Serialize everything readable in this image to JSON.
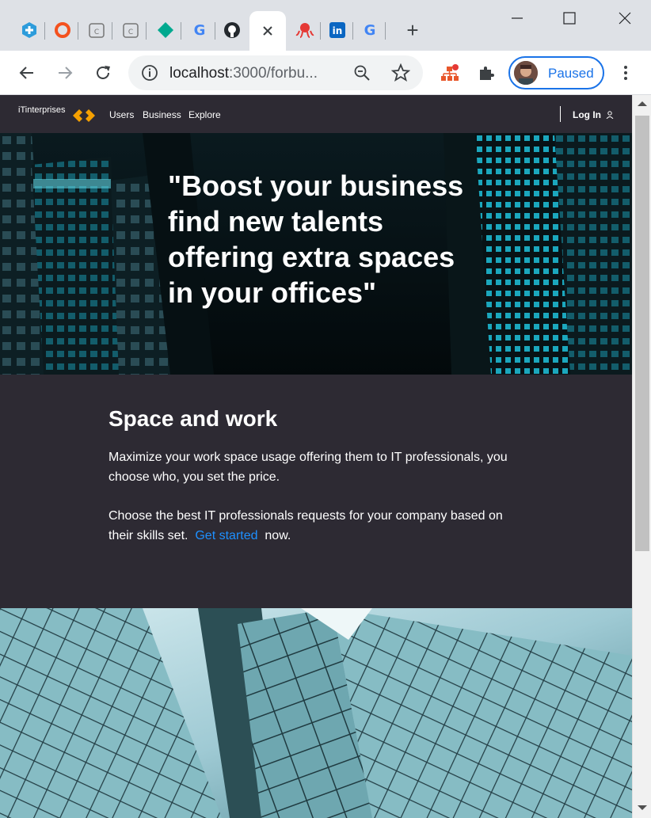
{
  "browser": {
    "tabs": [
      {
        "icon": "plus-shield-icon",
        "color": "#2d9cdb"
      },
      {
        "icon": "ring-icon",
        "color": "#f4511e"
      },
      {
        "icon": "calendar-c-icon",
        "color": "#9e9e9e",
        "glyph": "C"
      },
      {
        "icon": "calendar-c-icon",
        "color": "#9e9e9e",
        "glyph": "C"
      },
      {
        "icon": "diamond-icon",
        "color": "#00a98f"
      },
      {
        "icon": "google-icon",
        "glyph": "G"
      },
      {
        "icon": "github-icon",
        "color": "#24292e"
      },
      {
        "icon": "close-icon",
        "active": true
      },
      {
        "icon": "octopus-icon",
        "color": "#e53935"
      },
      {
        "icon": "linkedin-icon",
        "color": "#0a66c2",
        "glyph": "in"
      },
      {
        "icon": "google-icon",
        "glyph": "G"
      }
    ],
    "new_tab": "+",
    "url_host": "localhost",
    "url_rest": ":3000/forbu...",
    "profile_label": "Paused"
  },
  "site": {
    "brand": "iTinterprises",
    "nav": [
      "Users",
      "Business",
      "Explore"
    ],
    "login": "Log In",
    "hero_quote_lines": [
      "\"Boost your business",
      "find new talents",
      "offering extra spaces",
      "in your offices\""
    ],
    "section_title": "Space and work",
    "para1": "Maximize your work space usage offering them to IT professionals, you choose who, you set the price.",
    "para2_before": "Choose the best IT professionals requests for your company based on their skills set.",
    "get_started": "Get started",
    "para2_after": "now.",
    "accent": "#f5a000",
    "link_color": "#1e90ff"
  }
}
